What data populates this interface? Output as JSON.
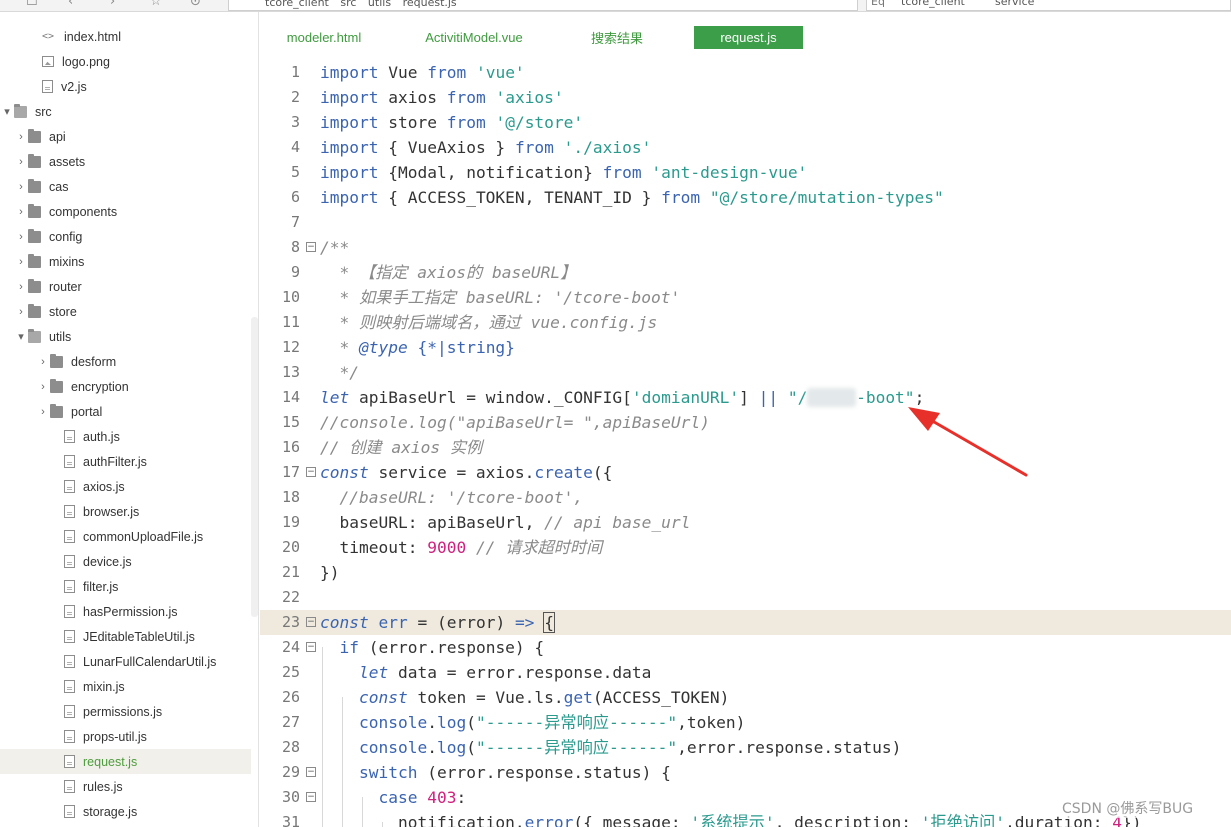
{
  "toolbar": {
    "path_segments": [
      "tcore_client",
      "src",
      "utils",
      "request.js"
    ],
    "search_segments": [
      "tcore_client",
      "service"
    ]
  },
  "sidebar": {
    "items": [
      {
        "label": "index.html",
        "icon": "html-file-icon",
        "chevron": ""
      },
      {
        "label": "logo.png",
        "icon": "image-file-icon",
        "chevron": ""
      },
      {
        "label": "v2.js",
        "icon": "file-icon",
        "chevron": ""
      },
      {
        "label": "src",
        "icon": "folder-open-icon",
        "chevron": "▾"
      },
      {
        "label": "api",
        "icon": "folder-icon",
        "chevron": "›"
      },
      {
        "label": "assets",
        "icon": "folder-icon",
        "chevron": "›"
      },
      {
        "label": "cas",
        "icon": "folder-icon",
        "chevron": "›"
      },
      {
        "label": "components",
        "icon": "folder-icon",
        "chevron": "›"
      },
      {
        "label": "config",
        "icon": "folder-icon",
        "chevron": "›"
      },
      {
        "label": "mixins",
        "icon": "folder-icon",
        "chevron": "›"
      },
      {
        "label": "router",
        "icon": "folder-icon",
        "chevron": "›"
      },
      {
        "label": "store",
        "icon": "folder-icon",
        "chevron": "›"
      },
      {
        "label": "utils",
        "icon": "folder-open-icon",
        "chevron": "▾"
      },
      {
        "label": "desform",
        "icon": "folder-icon",
        "chevron": "›"
      },
      {
        "label": "encryption",
        "icon": "folder-icon",
        "chevron": "›"
      },
      {
        "label": "portal",
        "icon": "folder-icon",
        "chevron": "›"
      },
      {
        "label": "auth.js",
        "icon": "file-icon",
        "chevron": ""
      },
      {
        "label": "authFilter.js",
        "icon": "file-icon",
        "chevron": ""
      },
      {
        "label": "axios.js",
        "icon": "file-icon",
        "chevron": ""
      },
      {
        "label": "browser.js",
        "icon": "file-icon",
        "chevron": ""
      },
      {
        "label": "commonUploadFile.js",
        "icon": "file-icon",
        "chevron": ""
      },
      {
        "label": "device.js",
        "icon": "file-icon",
        "chevron": ""
      },
      {
        "label": "filter.js",
        "icon": "file-icon",
        "chevron": ""
      },
      {
        "label": "hasPermission.js",
        "icon": "file-icon",
        "chevron": ""
      },
      {
        "label": "JEditableTableUtil.js",
        "icon": "file-icon",
        "chevron": ""
      },
      {
        "label": "LunarFullCalendarUtil.js",
        "icon": "file-icon",
        "chevron": ""
      },
      {
        "label": "mixin.js",
        "icon": "file-icon",
        "chevron": ""
      },
      {
        "label": "permissions.js",
        "icon": "file-icon",
        "chevron": ""
      },
      {
        "label": "props-util.js",
        "icon": "file-icon",
        "chevron": ""
      },
      {
        "label": "request.js",
        "icon": "file-icon",
        "chevron": "",
        "selected": true
      },
      {
        "label": "rules.js",
        "icon": "file-icon",
        "chevron": ""
      },
      {
        "label": "storage.js",
        "icon": "file-icon",
        "chevron": ""
      }
    ]
  },
  "tabs": [
    {
      "label": "modeler.html"
    },
    {
      "label": "ActivitiModel.vue"
    },
    {
      "label": "搜索结果"
    },
    {
      "label": "request.js",
      "active": true
    }
  ],
  "editor": {
    "line_numbers": [
      "1",
      "2",
      "3",
      "4",
      "5",
      "6",
      "7",
      "8",
      "9",
      "10",
      "11",
      "12",
      "13",
      "14",
      "15",
      "16",
      "17",
      "18",
      "19",
      "20",
      "21",
      "22",
      "23",
      "24",
      "25",
      "26",
      "27",
      "28",
      "29",
      "30",
      "31"
    ],
    "current_line": 23,
    "accent_color": "#3d9e4a"
  },
  "watermark": "CSDN @佛系写BUG"
}
